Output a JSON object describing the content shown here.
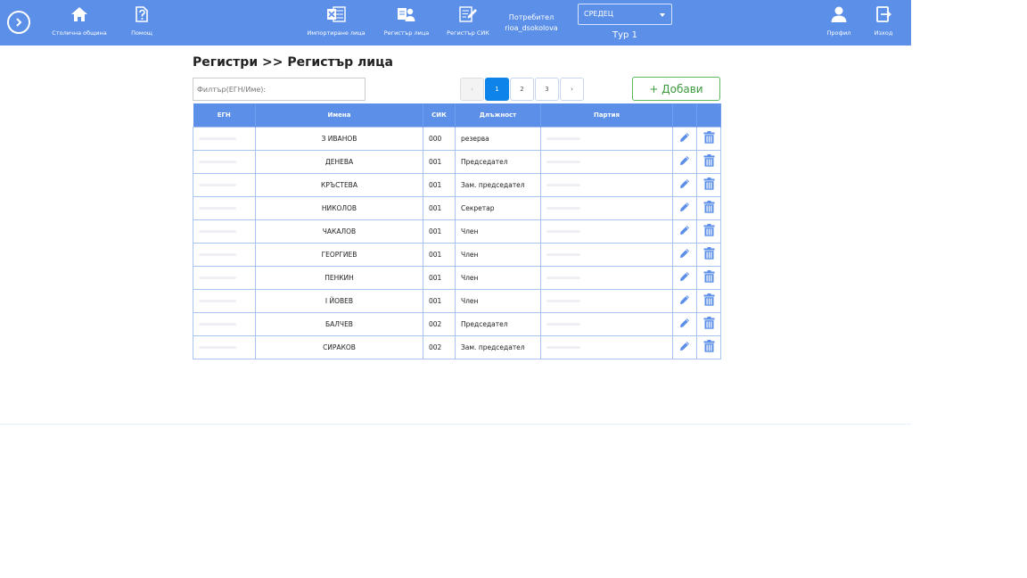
{
  "nav": {
    "items": [
      {
        "label": "Столична община",
        "icon": "home-icon"
      },
      {
        "label": "Помощ",
        "icon": "help-icon"
      },
      {
        "label": "Импортиране лица",
        "icon": "excel-icon"
      },
      {
        "label": "Регистър лица",
        "icon": "people-register-icon"
      },
      {
        "label": "Регистър СИК",
        "icon": "edit-register-icon"
      },
      {
        "label": "Профил",
        "icon": "user-icon"
      },
      {
        "label": "Изход",
        "icon": "logout-icon"
      }
    ],
    "user_label": "Потребител",
    "username": "rioa_dsokolova",
    "region": "СРЕДЕЦ",
    "round": "Тур 1"
  },
  "breadcrumb": "Регистри >> Регистър лица",
  "filter": {
    "placeholder": "Филтър(ЕГН/Име):"
  },
  "pager": {
    "prev": "‹",
    "pages": [
      "1",
      "2",
      "3"
    ],
    "next": "›",
    "active": "1"
  },
  "add_label": "+ Добави",
  "table": {
    "headers": [
      "ЕГН",
      "Имена",
      "СИК",
      "Длъжност",
      "Партия"
    ],
    "rows": [
      {
        "name": "З ИВАНОВ",
        "sik": "000",
        "position": "резерва"
      },
      {
        "name": "ДЕНЕВА",
        "sik": "001",
        "position": "Председател"
      },
      {
        "name": "КРЪСТЕВА",
        "sik": "001",
        "position": "Зам. председател"
      },
      {
        "name": "НИКОЛОВ",
        "sik": "001",
        "position": "Секретар"
      },
      {
        "name": "ЧАКАЛОВ",
        "sik": "001",
        "position": "Член"
      },
      {
        "name": "ГЕОРГИЕВ",
        "sik": "001",
        "position": "Член"
      },
      {
        "name": "ПЕНКИН",
        "sik": "001",
        "position": "Член"
      },
      {
        "name": "І ЙОВЕВ",
        "sik": "001",
        "position": "Член"
      },
      {
        "name": "БАЛЧЕВ",
        "sik": "002",
        "position": "Председател"
      },
      {
        "name": "СИРАКОВ",
        "sik": "002",
        "position": "Зам. председател"
      }
    ]
  },
  "colors": {
    "primary": "#5b8fe8",
    "active_page": "#0d84ea",
    "add_green": "#5cb85c"
  }
}
